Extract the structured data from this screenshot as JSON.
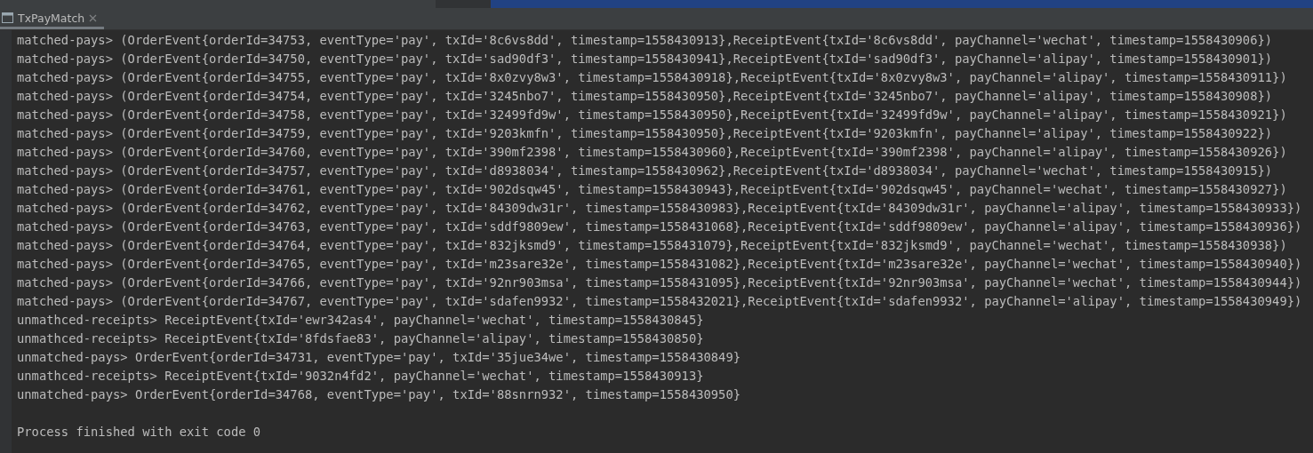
{
  "tab": {
    "title": "TxPayMatch",
    "selected": true
  },
  "console": {
    "lines": [
      "matched-pays> (OrderEvent{orderId=34753, eventType='pay', txId='8c6vs8dd', timestamp=1558430913},ReceiptEvent{txId='8c6vs8dd', payChannel='wechat', timestamp=1558430906})",
      "matched-pays> (OrderEvent{orderId=34750, eventType='pay', txId='sad90df3', timestamp=1558430941},ReceiptEvent{txId='sad90df3', payChannel='alipay', timestamp=1558430901})",
      "matched-pays> (OrderEvent{orderId=34755, eventType='pay', txId='8x0zvy8w3', timestamp=1558430918},ReceiptEvent{txId='8x0zvy8w3', payChannel='alipay', timestamp=1558430911})",
      "matched-pays> (OrderEvent{orderId=34754, eventType='pay', txId='3245nbo7', timestamp=1558430950},ReceiptEvent{txId='3245nbo7', payChannel='alipay', timestamp=1558430908})",
      "matched-pays> (OrderEvent{orderId=34758, eventType='pay', txId='32499fd9w', timestamp=1558430950},ReceiptEvent{txId='32499fd9w', payChannel='alipay', timestamp=1558430921})",
      "matched-pays> (OrderEvent{orderId=34759, eventType='pay', txId='9203kmfn', timestamp=1558430950},ReceiptEvent{txId='9203kmfn', payChannel='alipay', timestamp=1558430922})",
      "matched-pays> (OrderEvent{orderId=34760, eventType='pay', txId='390mf2398', timestamp=1558430960},ReceiptEvent{txId='390mf2398', payChannel='alipay', timestamp=1558430926})",
      "matched-pays> (OrderEvent{orderId=34757, eventType='pay', txId='d8938034', timestamp=1558430962},ReceiptEvent{txId='d8938034', payChannel='wechat', timestamp=1558430915})",
      "matched-pays> (OrderEvent{orderId=34761, eventType='pay', txId='902dsqw45', timestamp=1558430943},ReceiptEvent{txId='902dsqw45', payChannel='wechat', timestamp=1558430927})",
      "matched-pays> (OrderEvent{orderId=34762, eventType='pay', txId='84309dw31r', timestamp=1558430983},ReceiptEvent{txId='84309dw31r', payChannel='alipay', timestamp=1558430933})",
      "matched-pays> (OrderEvent{orderId=34763, eventType='pay', txId='sddf9809ew', timestamp=1558431068},ReceiptEvent{txId='sddf9809ew', payChannel='alipay', timestamp=1558430936})",
      "matched-pays> (OrderEvent{orderId=34764, eventType='pay', txId='832jksmd9', timestamp=1558431079},ReceiptEvent{txId='832jksmd9', payChannel='wechat', timestamp=1558430938})",
      "matched-pays> (OrderEvent{orderId=34765, eventType='pay', txId='m23sare32e', timestamp=1558431082},ReceiptEvent{txId='m23sare32e', payChannel='wechat', timestamp=1558430940})",
      "matched-pays> (OrderEvent{orderId=34766, eventType='pay', txId='92nr903msa', timestamp=1558431095},ReceiptEvent{txId='92nr903msa', payChannel='wechat', timestamp=1558430944})",
      "matched-pays> (OrderEvent{orderId=34767, eventType='pay', txId='sdafen9932', timestamp=1558432021},ReceiptEvent{txId='sdafen9932', payChannel='alipay', timestamp=1558430949})",
      "unmathced-receipts> ReceiptEvent{txId='ewr342as4', payChannel='wechat', timestamp=1558430845}",
      "unmathced-receipts> ReceiptEvent{txId='8fdsfae83', payChannel='alipay', timestamp=1558430850}",
      "unmatched-pays> OrderEvent{orderId=34731, eventType='pay', txId='35jue34we', timestamp=1558430849}",
      "unmathced-receipts> ReceiptEvent{txId='9032n4fd2', payChannel='wechat', timestamp=1558430913}",
      "unmatched-pays> OrderEvent{orderId=34768, eventType='pay', txId='88snrn932', timestamp=1558430950}"
    ],
    "exit_message": "Process finished with exit code 0"
  }
}
